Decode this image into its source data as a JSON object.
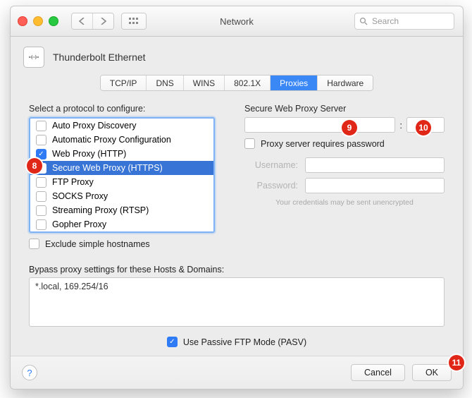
{
  "window": {
    "title": "Network"
  },
  "titlebar": {
    "search_placeholder": "Search"
  },
  "interface": {
    "name": "Thunderbolt Ethernet"
  },
  "tabs": [
    {
      "id": "tcpip",
      "label": "TCP/IP",
      "active": false
    },
    {
      "id": "dns",
      "label": "DNS",
      "active": false
    },
    {
      "id": "wins",
      "label": "WINS",
      "active": false
    },
    {
      "id": "8021x",
      "label": "802.1X",
      "active": false
    },
    {
      "id": "proxies",
      "label": "Proxies",
      "active": true
    },
    {
      "id": "hw",
      "label": "Hardware",
      "active": false
    }
  ],
  "leftcol": {
    "heading": "Select a protocol to configure:",
    "protocols": [
      {
        "label": "Auto Proxy Discovery",
        "checked": false,
        "selected": false
      },
      {
        "label": "Automatic Proxy Configuration",
        "checked": false,
        "selected": false
      },
      {
        "label": "Web Proxy (HTTP)",
        "checked": true,
        "selected": false
      },
      {
        "label": "Secure Web Proxy (HTTPS)",
        "checked": true,
        "selected": true
      },
      {
        "label": "FTP Proxy",
        "checked": false,
        "selected": false
      },
      {
        "label": "SOCKS Proxy",
        "checked": false,
        "selected": false
      },
      {
        "label": "Streaming Proxy (RTSP)",
        "checked": false,
        "selected": false
      },
      {
        "label": "Gopher Proxy",
        "checked": false,
        "selected": false
      }
    ],
    "exclude_simple_label": "Exclude simple hostnames",
    "exclude_simple_checked": false
  },
  "rightcol": {
    "heading": "Secure Web Proxy Server",
    "host": "",
    "port": "",
    "port_sep": ":",
    "requires_password_label": "Proxy server requires password",
    "requires_password_checked": false,
    "username_label": "Username:",
    "username_value": "",
    "password_label": "Password:",
    "password_value": "",
    "credentials_note": "Your credentials may be sent unencrypted"
  },
  "bypass": {
    "heading": "Bypass proxy settings for these Hosts & Domains:",
    "value": "*.local, 169.254/16"
  },
  "passive_ftp": {
    "label": "Use Passive FTP Mode (PASV)",
    "checked": true
  },
  "footer": {
    "cancel": "Cancel",
    "ok": "OK"
  },
  "annotations": {
    "b8": "8",
    "b9": "9",
    "b10": "10",
    "b11": "11"
  },
  "colors": {
    "accent": "#2f7bf5",
    "badge": "#e02617"
  }
}
